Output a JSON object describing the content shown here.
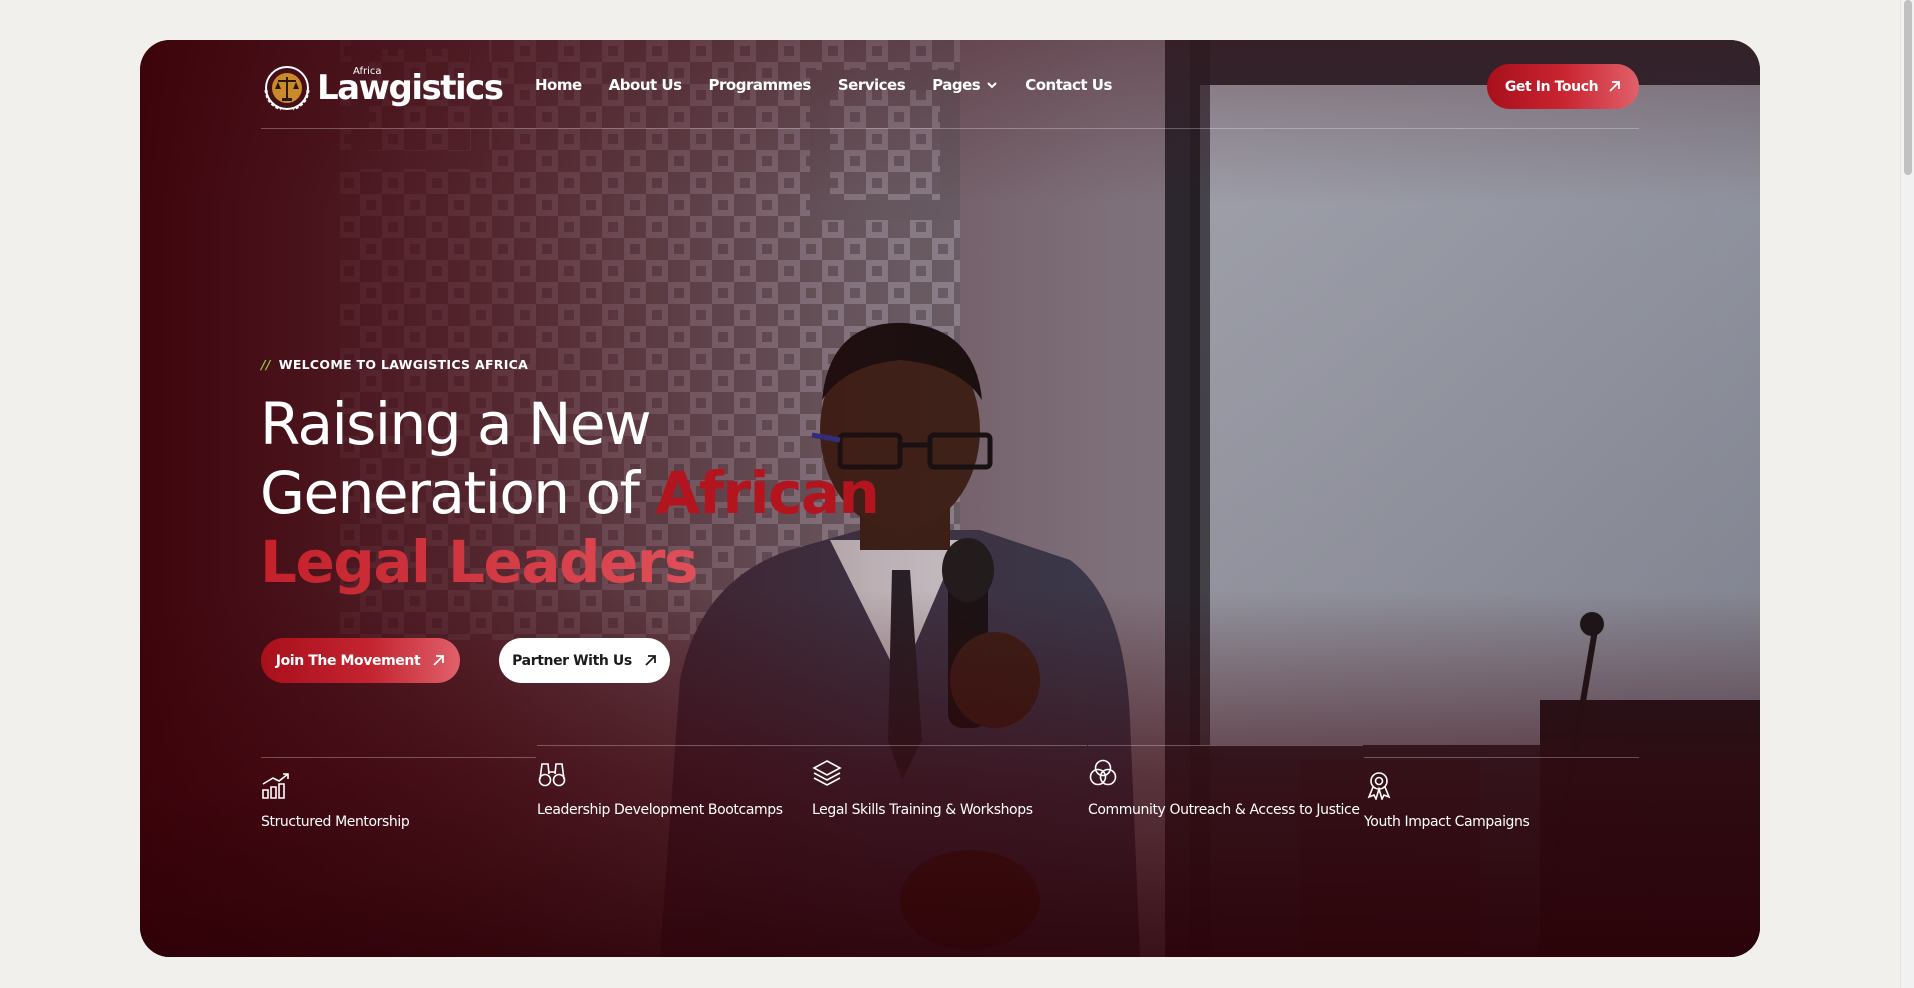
{
  "brand": {
    "name": "Lawgistics",
    "superscript": "Africa"
  },
  "nav": {
    "items": [
      {
        "label": "Home"
      },
      {
        "label": "About Us"
      },
      {
        "label": "Programmes"
      },
      {
        "label": "Services"
      },
      {
        "label": "Pages"
      },
      {
        "label": "Contact Us"
      }
    ]
  },
  "header": {
    "cta_label": "Get In Touch"
  },
  "hero": {
    "eyebrow_prefix": "//",
    "eyebrow": "WELCOME TO LAWGISTICS AFRICA",
    "headline_line1": "Raising a New",
    "headline_line2_plain": "Generation of ",
    "headline_line2_accent": "African",
    "headline_line3_accent": "Legal Leaders",
    "primary_button": "Join The Movement",
    "secondary_button": "Partner With Us"
  },
  "features": [
    {
      "label": "Structured Mentorship",
      "icon": "bar-chart-icon"
    },
    {
      "label": "Leadership Development Bootcamps",
      "icon": "binoculars-icon"
    },
    {
      "label": "Legal Skills Training & Workshops",
      "icon": "layers-icon"
    },
    {
      "label": "Community Outreach & Access to Justice",
      "icon": "circles-icon"
    },
    {
      "label": "Youth Impact Campaigns",
      "icon": "award-icon"
    }
  ],
  "colors": {
    "accent": "#b3141e",
    "accent_light": "#e0616a",
    "eyebrow_slashes": "#8bc34a",
    "page_bg": "#f1f0ec"
  }
}
